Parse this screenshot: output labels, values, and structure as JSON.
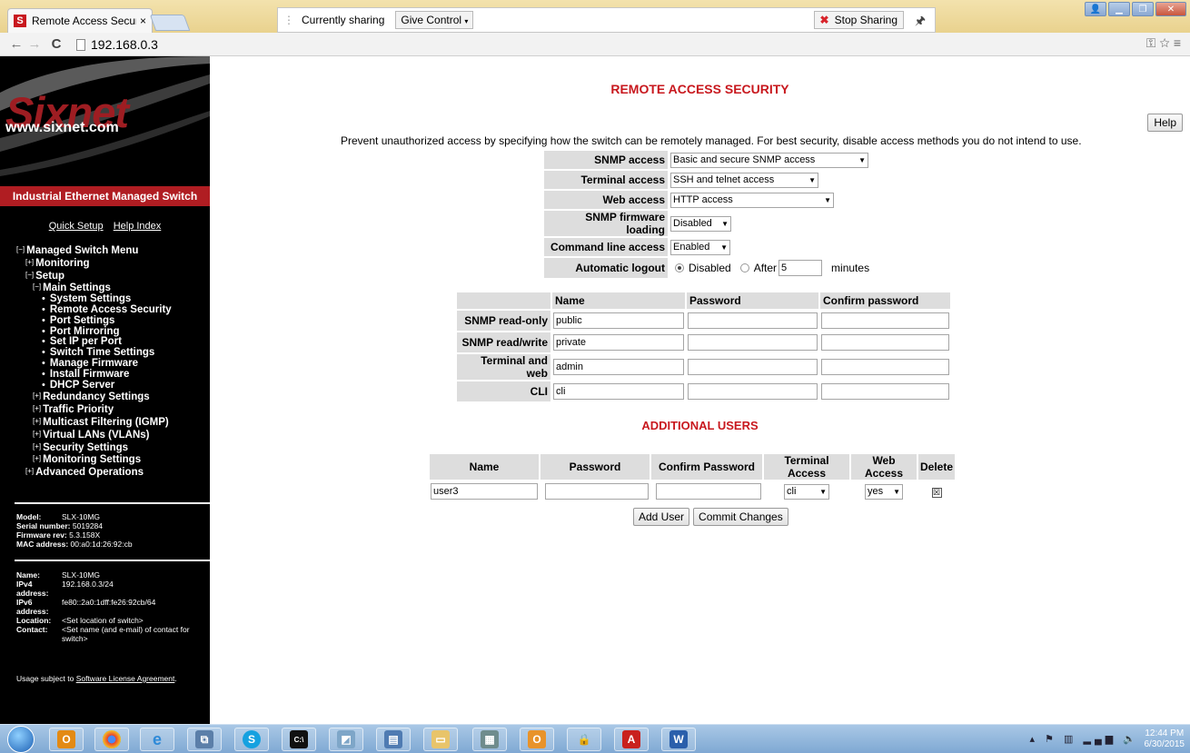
{
  "browser": {
    "tab_title": "Remote Access Security -",
    "tab_close": "×",
    "favicon": "S",
    "url": "192.168.0.3"
  },
  "sharing": {
    "status": "Currently sharing",
    "give_control": "Give Control",
    "stop_sharing": "Stop Sharing"
  },
  "sidebar": {
    "logo_text": "Sixnet",
    "logo_url": "www.sixnet.com",
    "product": "Industrial Ethernet Managed Switch",
    "links": [
      "Quick Setup",
      "Help Index"
    ],
    "menu": [
      {
        "toggle": "[−]",
        "label": "Managed Switch Menu",
        "indent": 0
      },
      {
        "toggle": "[+]",
        "label": "Monitoring",
        "indent": 1
      },
      {
        "toggle": "[−]",
        "label": "Setup",
        "indent": 1
      },
      {
        "toggle": "[−]",
        "label": "Main Settings",
        "indent": 2
      },
      {
        "toggle": "•",
        "label": "System Settings",
        "indent": 3
      },
      {
        "toggle": "•",
        "label": "Remote Access Security",
        "indent": 3
      },
      {
        "toggle": "•",
        "label": "Port Settings",
        "indent": 3
      },
      {
        "toggle": "•",
        "label": "Port Mirroring",
        "indent": 3
      },
      {
        "toggle": "•",
        "label": "Set IP per Port",
        "indent": 3
      },
      {
        "toggle": "•",
        "label": "Switch Time Settings",
        "indent": 3
      },
      {
        "toggle": "•",
        "label": "Manage Firmware",
        "indent": 3
      },
      {
        "toggle": "•",
        "label": "Install Firmware",
        "indent": 3
      },
      {
        "toggle": "•",
        "label": "DHCP Server",
        "indent": 3
      },
      {
        "toggle": "[+]",
        "label": "Redundancy Settings",
        "indent": 2
      },
      {
        "toggle": "[+]",
        "label": "Traffic Priority",
        "indent": 2
      },
      {
        "toggle": "[+]",
        "label": "Multicast Filtering (IGMP)",
        "indent": 2
      },
      {
        "toggle": "[+]",
        "label": "Virtual LANs (VLANs)",
        "indent": 2
      },
      {
        "toggle": "[+]",
        "label": "Security Settings",
        "indent": 2
      },
      {
        "toggle": "[+]",
        "label": "Monitoring Settings",
        "indent": 2
      },
      {
        "toggle": "[+]",
        "label": "Advanced Operations",
        "indent": 1
      }
    ],
    "device": {
      "model_label": "Model:",
      "model": "SLX-10MG",
      "serial_label": "Serial number:",
      "serial": "5019284",
      "firmware_label": "Firmware rev:",
      "firmware": "5.3.158X",
      "mac_label": "MAC address:",
      "mac": "00:a0:1d:26:92:cb"
    },
    "network": {
      "name_label": "Name:",
      "name": "SLX-10MG",
      "ipv4_label": "IPv4 address:",
      "ipv4": "192.168.0.3/24",
      "ipv6_label": "IPv6 address:",
      "ipv6": "fe80::2a0:1dff:fe26:92cb/64",
      "location_label": "Location:",
      "location": "<Set location of switch>",
      "contact_label": "Contact:",
      "contact": "<Set name (and e-mail) of contact for switch>"
    },
    "usage_prefix": "Usage subject to ",
    "usage_link": "Software License Agreement",
    "usage_suffix": "."
  },
  "main": {
    "title": "REMOTE ACCESS SECURITY",
    "help": "Help",
    "intro": "Prevent unauthorized access by specifying how the switch can be remotely managed. For best security, disable access methods you do not intend to use.",
    "access": [
      {
        "label": "SNMP access",
        "value": "Basic and secure SNMP access"
      },
      {
        "label": "Terminal access",
        "value": "SSH and telnet access"
      },
      {
        "label": "Web access",
        "value": "HTTP access"
      },
      {
        "label": "SNMP firmware loading",
        "value": "Disabled"
      },
      {
        "label": "Command line access",
        "value": "Enabled"
      }
    ],
    "logout": {
      "label": "Automatic logout",
      "disabled": "Disabled",
      "after": "After",
      "minutes_value": "5",
      "minutes": "minutes"
    },
    "cred_headers": [
      "Name",
      "Password",
      "Confirm password"
    ],
    "creds": [
      {
        "label": "SNMP read-only",
        "name": "public"
      },
      {
        "label": "SNMP read/write",
        "name": "private"
      },
      {
        "label": "Terminal and web",
        "name": "admin"
      },
      {
        "label": "CLI",
        "name": "cli"
      }
    ],
    "additional_title": "ADDITIONAL USERS",
    "user_headers": [
      "Name",
      "Password",
      "Confirm Password",
      "Terminal Access",
      "Web Access",
      "Delete"
    ],
    "users": [
      {
        "name": "user3",
        "terminal": "cli",
        "web": "yes",
        "delete": "☒"
      }
    ],
    "add_user": "Add User",
    "commit": "Commit Changes"
  },
  "taskbar": {
    "clock_time": "12:44 PM",
    "clock_date": "6/30/2015"
  }
}
